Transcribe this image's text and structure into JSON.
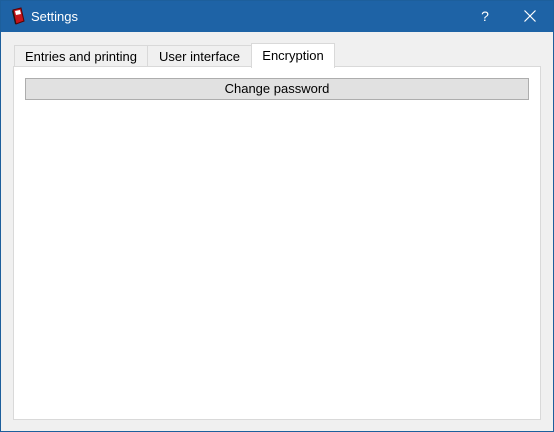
{
  "window": {
    "title": "Settings",
    "help_label": "?",
    "app_icon": "book-icon",
    "close_icon": "close-icon",
    "colors": {
      "titlebar": "#1e63a6",
      "panel": "#ffffff",
      "button": "#e1e1e1"
    }
  },
  "tabs": [
    {
      "label": "Entries and printing",
      "selected": false
    },
    {
      "label": "User interface",
      "selected": false
    },
    {
      "label": "Encryption",
      "selected": true
    }
  ],
  "encryption_tab": {
    "change_password_label": "Change password"
  }
}
